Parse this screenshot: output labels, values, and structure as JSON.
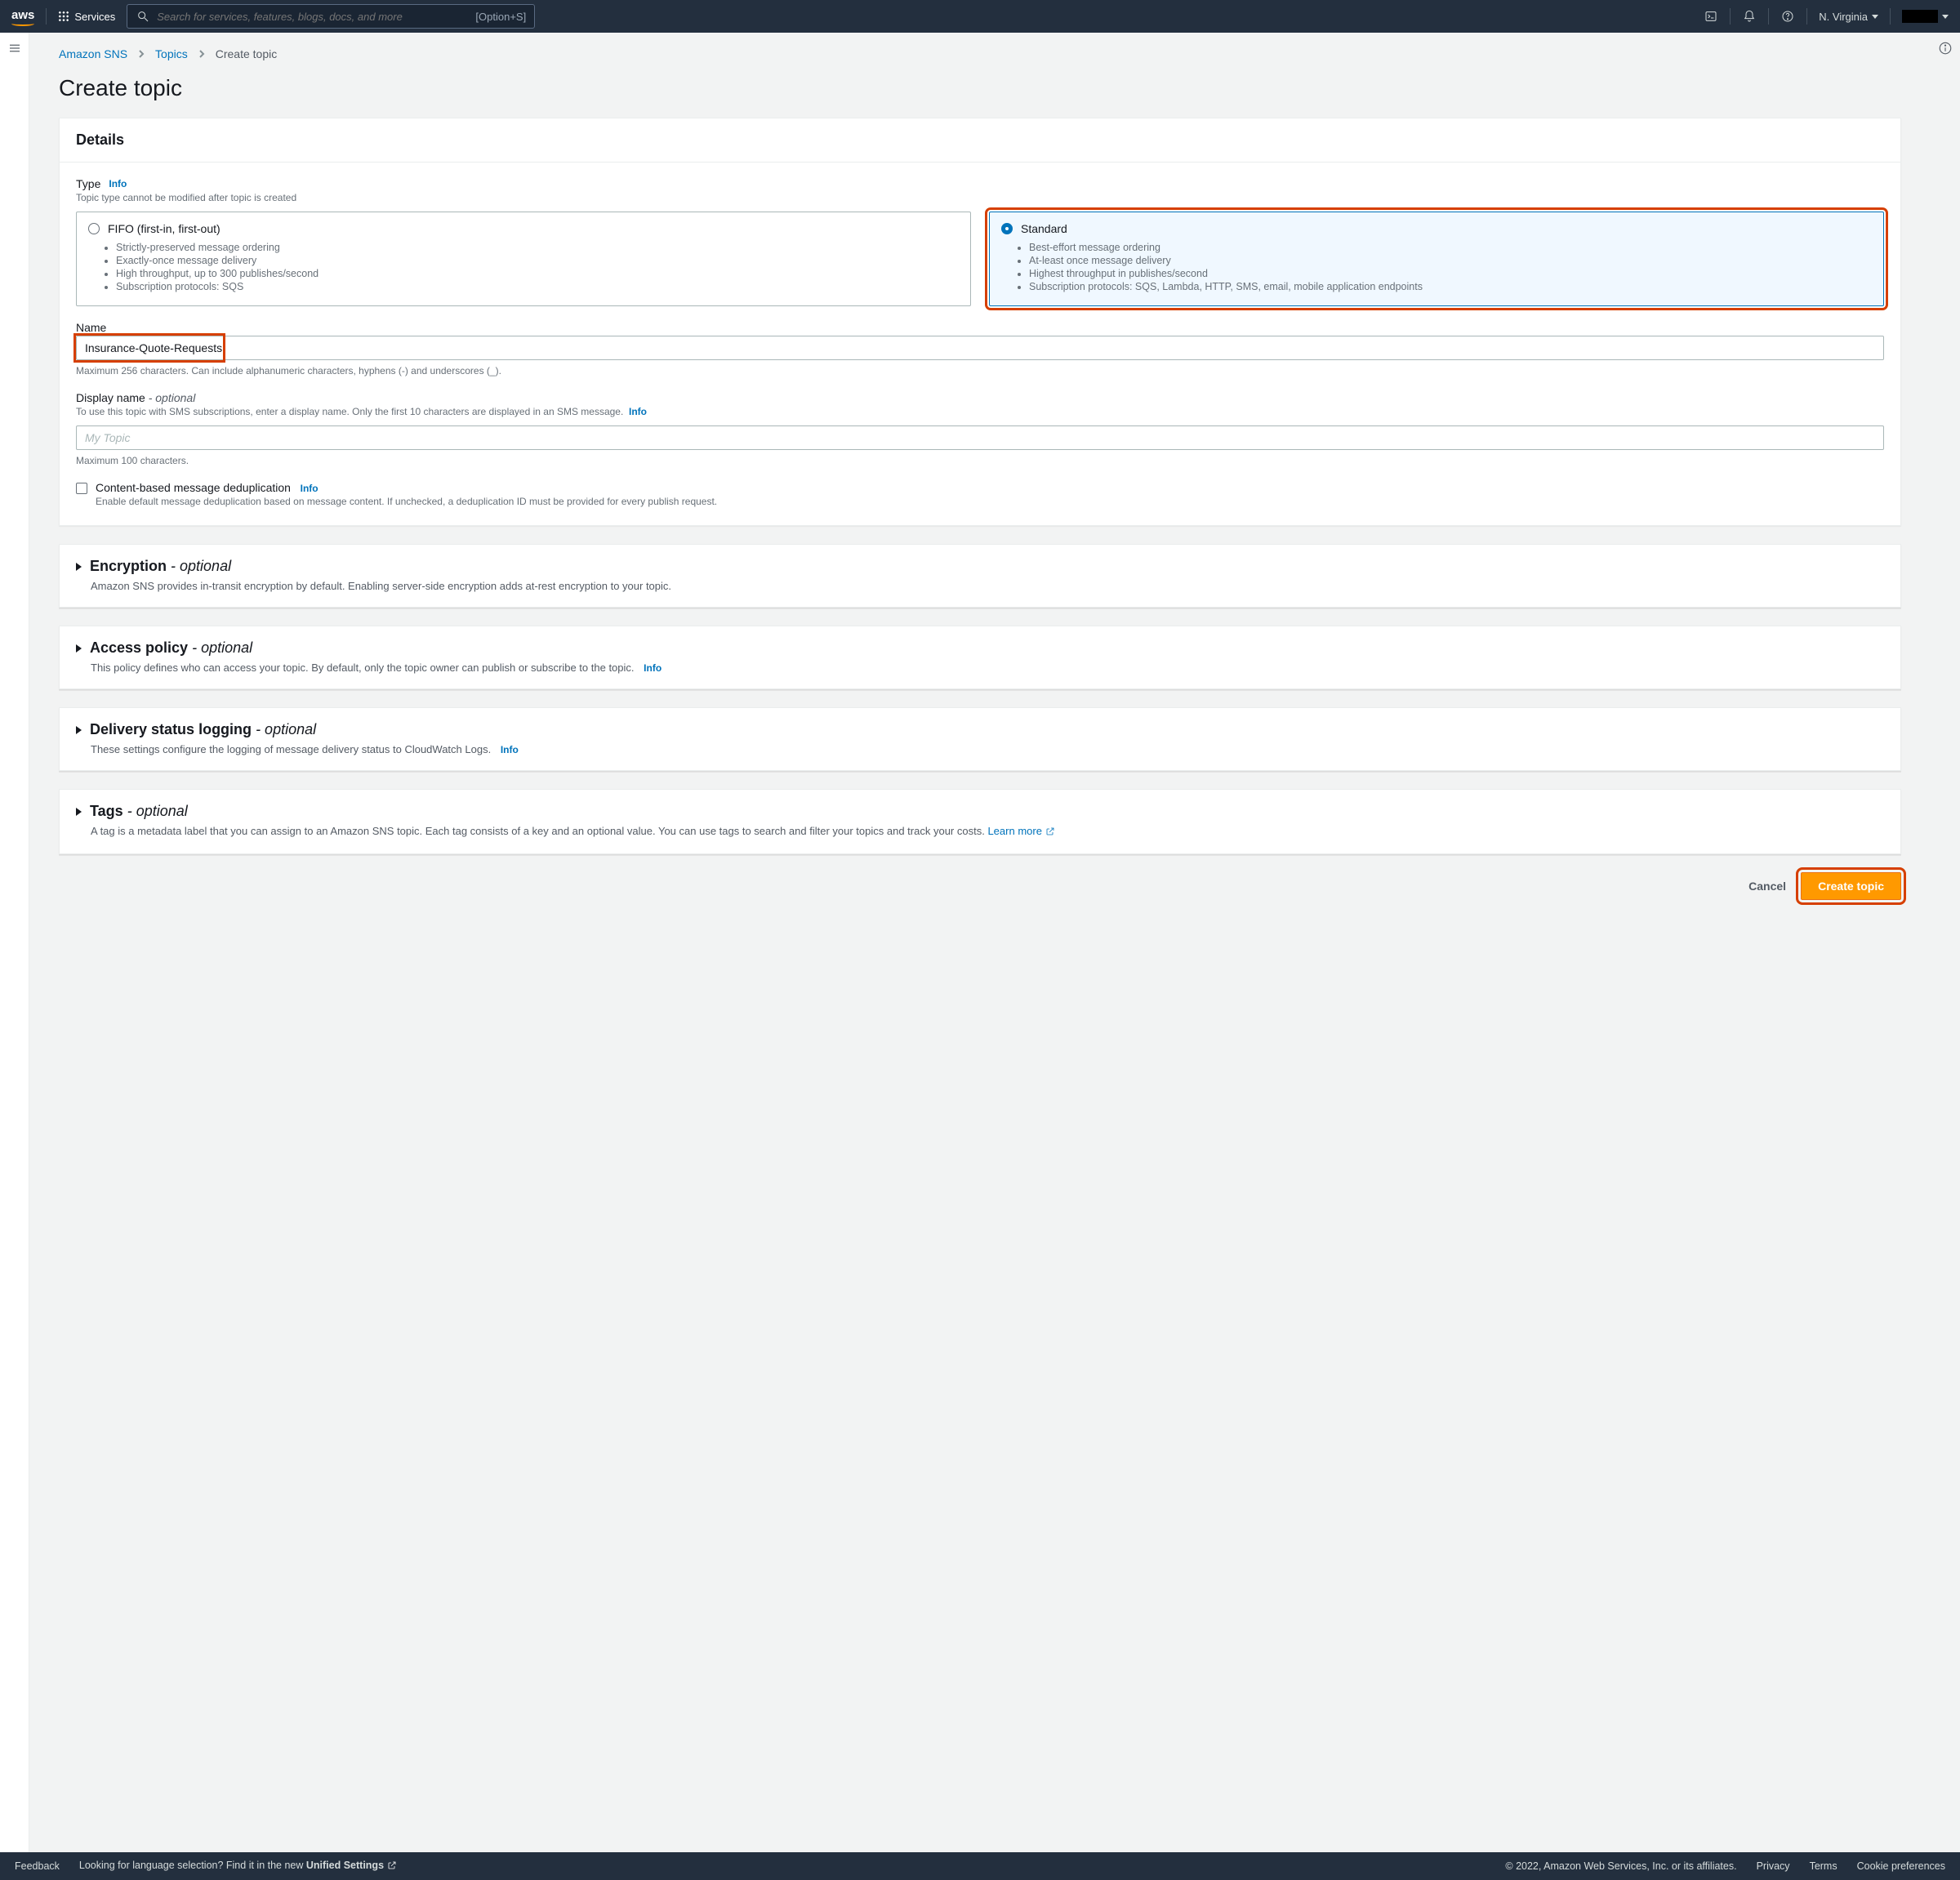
{
  "topnav": {
    "logo": "aws",
    "services": "Services",
    "search_placeholder": "Search for services, features, blogs, docs, and more",
    "shortcut": "[Option+S]",
    "region": "N. Virginia"
  },
  "breadcrumb": {
    "a": "Amazon SNS",
    "b": "Topics",
    "c": "Create topic"
  },
  "page_title": "Create topic",
  "details": {
    "header": "Details",
    "type_label": "Type",
    "info": "Info",
    "type_desc": "Topic type cannot be modified after topic is created",
    "fifo": {
      "title": "FIFO (first-in, first-out)",
      "bullets": [
        "Strictly-preserved message ordering",
        "Exactly-once message delivery",
        "High throughput, up to 300 publishes/second",
        "Subscription protocols: SQS"
      ]
    },
    "standard": {
      "title": "Standard",
      "bullets": [
        "Best-effort message ordering",
        "At-least once message delivery",
        "Highest throughput in publishes/second",
        "Subscription protocols: SQS, Lambda, HTTP, SMS, email, mobile application endpoints"
      ]
    },
    "name_label": "Name",
    "name_value": "Insurance-Quote-Requests",
    "name_hint": "Maximum 256 characters. Can include alphanumeric characters, hyphens (-) and underscores (_).",
    "display_label": "Display name",
    "optional": "- optional",
    "display_desc": "To use this topic with SMS subscriptions, enter a display name. Only the first 10 characters are displayed in an SMS message.",
    "display_placeholder": "My Topic",
    "display_hint": "Maximum 100 characters.",
    "dedup_label": "Content-based message deduplication",
    "dedup_desc": "Enable default message deduplication based on message content. If unchecked, a deduplication ID must be provided for every publish request."
  },
  "encryption": {
    "title": "Encryption",
    "desc": "Amazon SNS provides in-transit encryption by default. Enabling server-side encryption adds at-rest encryption to your topic."
  },
  "access": {
    "title": "Access policy",
    "desc": "This policy defines who can access your topic. By default, only the topic owner can publish or subscribe to the topic."
  },
  "delivery": {
    "title": "Delivery status logging",
    "desc": "These settings configure the logging of message delivery status to CloudWatch Logs."
  },
  "tags": {
    "title": "Tags",
    "desc": "A tag is a metadata label that you can assign to an Amazon SNS topic. Each tag consists of a key and an optional value. You can use tags to search and filter your topics and track your costs.",
    "learn": "Learn more"
  },
  "buttons": {
    "cancel": "Cancel",
    "create": "Create topic"
  },
  "footer": {
    "feedback": "Feedback",
    "lang_q": "Looking for language selection? Find it in the new ",
    "unified": "Unified Settings",
    "copyright": "© 2022, Amazon Web Services, Inc. or its affiliates.",
    "privacy": "Privacy",
    "terms": "Terms",
    "cookie": "Cookie preferences"
  }
}
